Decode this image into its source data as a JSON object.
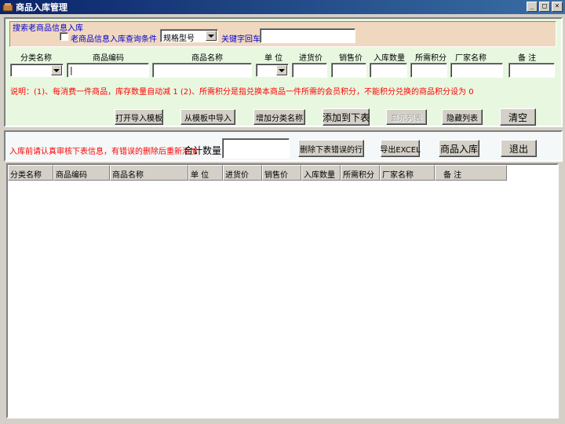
{
  "window": {
    "title": "商品入库管理",
    "controls": [
      "_",
      "□",
      "×"
    ]
  },
  "search": {
    "group_title": "搜索老商品信息入库",
    "checkbox_label": "老商品信息入库",
    "query_label": "查询条件",
    "query_value": "规格型号",
    "keyword_label": "关键字回车",
    "keyword_value": ""
  },
  "fields": {
    "category": "分类名称",
    "code": "商品编码",
    "name": "商品名称",
    "unit": "单 位",
    "purchase_price": "进货价",
    "sale_price": "销售价",
    "quantity": "入库数量",
    "points": "所需积分",
    "manufacturer": "厂家名称",
    "remark": "备 注",
    "code_value": "|"
  },
  "note": "说明：(1)、每消费一件商品，库存数量自动减 1 (2)、所需积分是指兑换本商品一件所需的会员积分，不能积分兑换的商品积分设为 0",
  "buttons": {
    "open_template": "打开导入模板",
    "import_from_template": "从模板中导入",
    "add_category": "增加分类名称",
    "add_to_table": "添加到下表",
    "show_list": "显示列表",
    "hide_list": "隐藏列表",
    "clear": "清空",
    "delete_error_rows": "删除下表错误的行",
    "export_excel": "导出EXCEL",
    "stock_in": "商品入库",
    "exit": "退出"
  },
  "warning": "入库前请认真审核下表信息，有错误的删除后重新添加",
  "total_label": "合计数量",
  "total_value": "",
  "table": {
    "columns": [
      "分类名称",
      "商品编码",
      "商品名称",
      "单 位",
      "进货价",
      "销售价",
      "入库数量",
      "所需积分",
      "厂家名称",
      "备 注"
    ]
  },
  "colors": {
    "title_bar": "#0a246a",
    "top_panel": "#e8f8e0",
    "search_group": "#f0d8c0",
    "note_text": "#ff0000",
    "label_blue": "#0000cc"
  }
}
